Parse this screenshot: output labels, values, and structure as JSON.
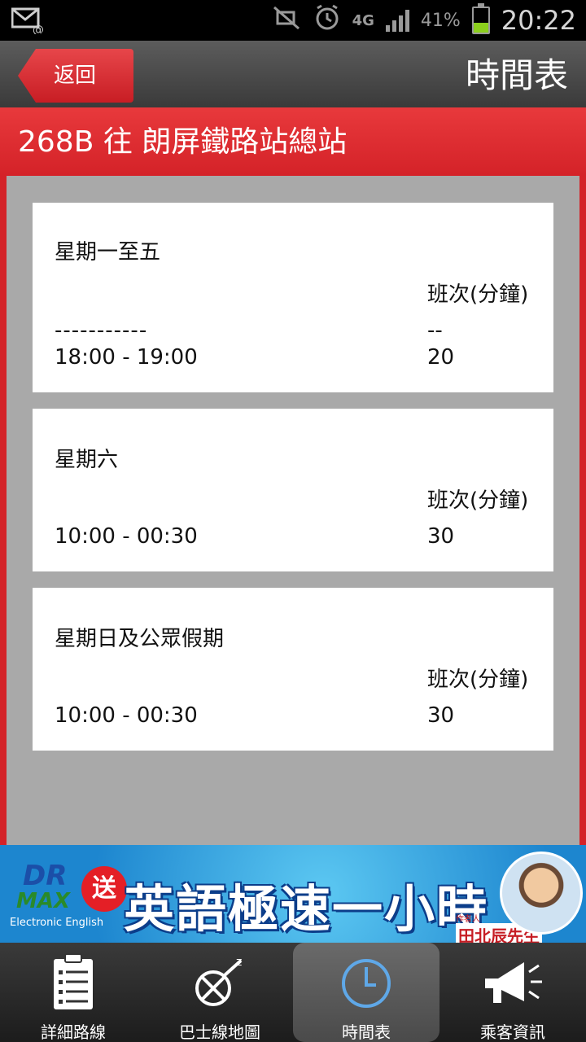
{
  "status_bar": {
    "battery": "41%",
    "battery_level": 0.41,
    "network": "4G",
    "time": "20:22",
    "icons": [
      "email-icon",
      "mute-icon",
      "alarm-icon",
      "network-4g-icon",
      "signal-icon",
      "battery-icon"
    ]
  },
  "header": {
    "back_label": "返回",
    "title": "時間表"
  },
  "route": {
    "title": "268B 往 朗屏鐵路站總站"
  },
  "schedules": [
    {
      "day": "星期一至五",
      "freq_header": "班次(分鐘)",
      "dash_left": "-----------",
      "dash_right": "--",
      "range": "18:00 - 19:00",
      "freq": "20"
    },
    {
      "day": "星期六",
      "freq_header": "班次(分鐘)",
      "range": "10:00 - 00:30",
      "freq": "30"
    },
    {
      "day": "星期日及公眾假期",
      "freq_header": "班次(分鐘)",
      "range": "10:00 - 00:30",
      "freq": "30"
    }
  ],
  "ad": {
    "logo_dr": "DR",
    "logo_max": "MAX",
    "logo_sub": "Electronic English",
    "send": "送",
    "slogan": "英語極速一小時",
    "author_tag": "作者人",
    "author": "田北辰先生"
  },
  "tabs": [
    {
      "label": "詳細路線",
      "icon": "route-list-icon",
      "active": false
    },
    {
      "label": "巴士線地圖",
      "icon": "map-icon",
      "active": false
    },
    {
      "label": "時間表",
      "icon": "clock-icon",
      "active": true
    },
    {
      "label": "乘客資訊",
      "icon": "megaphone-icon",
      "active": false
    }
  ],
  "colors": {
    "accent_red": "#d42228",
    "content_gray": "#a9a9a9",
    "tab_clock": "#5fa8e8"
  }
}
